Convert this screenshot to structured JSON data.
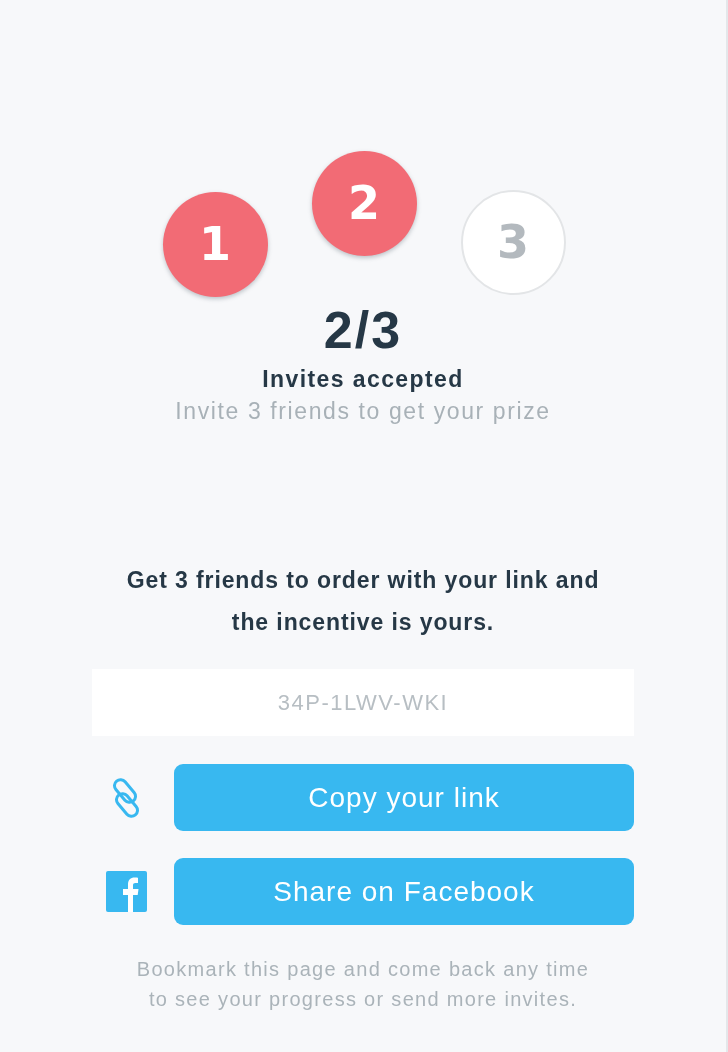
{
  "steps": [
    {
      "number": "1",
      "completed": true
    },
    {
      "number": "2",
      "completed": true
    },
    {
      "number": "3",
      "completed": false
    }
  ],
  "progress": {
    "count": "2/3",
    "label": "Invites accepted",
    "hint": "Invite 3 friends to get your prize"
  },
  "instructions": "Get 3 friends to order with your link and the incentive is yours.",
  "link_field": {
    "value": "34P-1LWV-WKI"
  },
  "actions": [
    {
      "kind": "link",
      "label": "Copy your link"
    },
    {
      "kind": "facebook",
      "label": "Share on Facebook"
    }
  ],
  "footer": "Bookmark this page and come back any time to see your progress or send more invites."
}
